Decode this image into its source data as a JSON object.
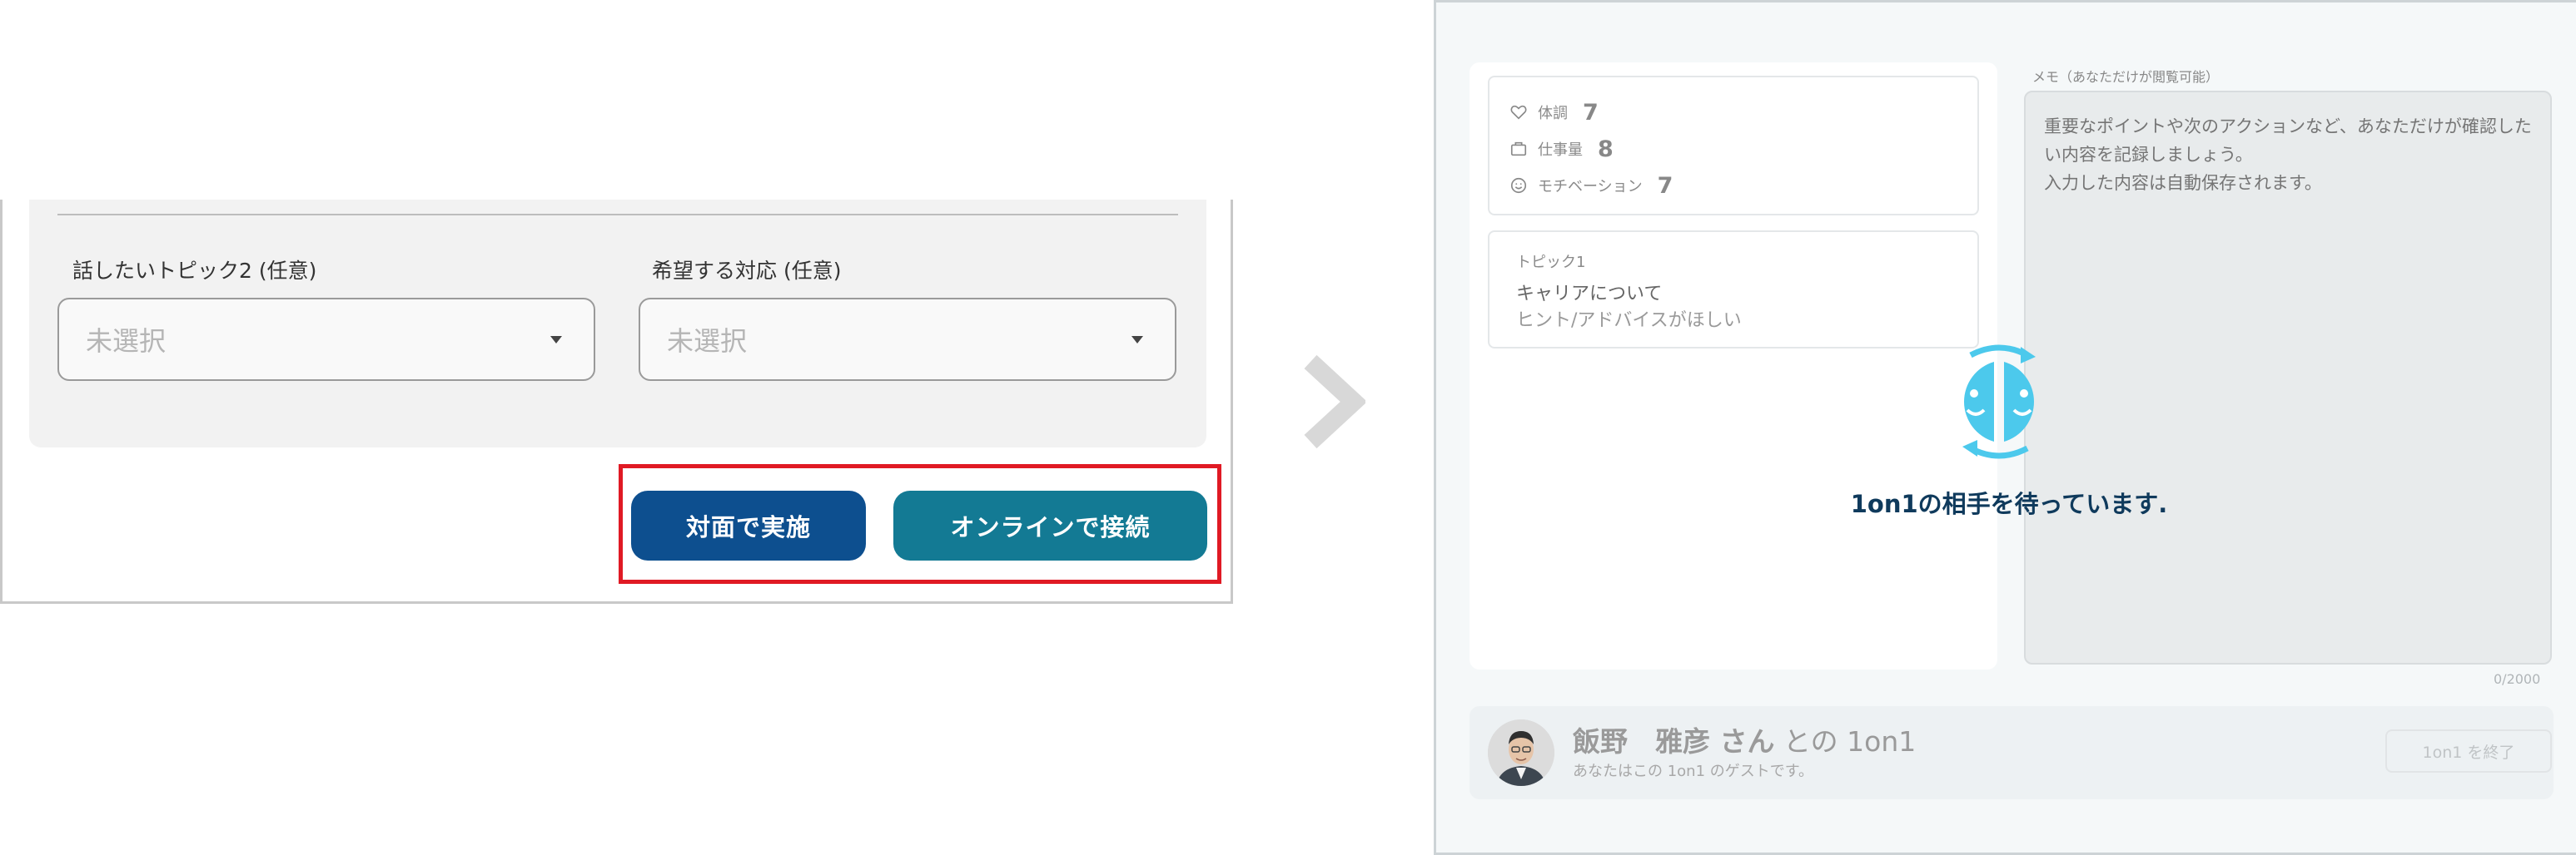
{
  "left_panel": {
    "topic2_label": "話したいトピック2 (任意)",
    "response_label": "希望する対応 (任意)",
    "topic2_placeholder": "未選択",
    "response_placeholder": "未選択",
    "in_person_button": "対面で実施",
    "online_button": "オンラインで接続",
    "highlight_color": "#e01a24"
  },
  "right_panel": {
    "status": [
      {
        "icon": "heart-icon",
        "label": "体調",
        "value": "7"
      },
      {
        "icon": "briefcase-icon",
        "label": "仕事量",
        "value": "8"
      },
      {
        "icon": "smile-icon",
        "label": "モチベーション",
        "value": "7"
      }
    ],
    "topic": {
      "label": "トピック1",
      "title": "キャリアについて",
      "subtitle": "ヒント/アドバイスがほしい"
    },
    "memo": {
      "label": "メモ（あなただけが閲覧可能）",
      "placeholder": "重要なポイントや次のアクションなど、あなただけが確認したい内容を記録しましょう。\n入力した内容は自動保存されます。",
      "count": "0/2000"
    },
    "waiting_text": "1on1の相手を待っています.",
    "footer": {
      "name": "飯野　雅彦 さん",
      "name_suffix": " との 1on1",
      "subtitle": "あなたはこの 1on1 のゲストです。",
      "end_button": "1on1 を終了"
    },
    "accent_color": "#4cc9ec",
    "waiting_text_color": "#0f3a5c"
  }
}
